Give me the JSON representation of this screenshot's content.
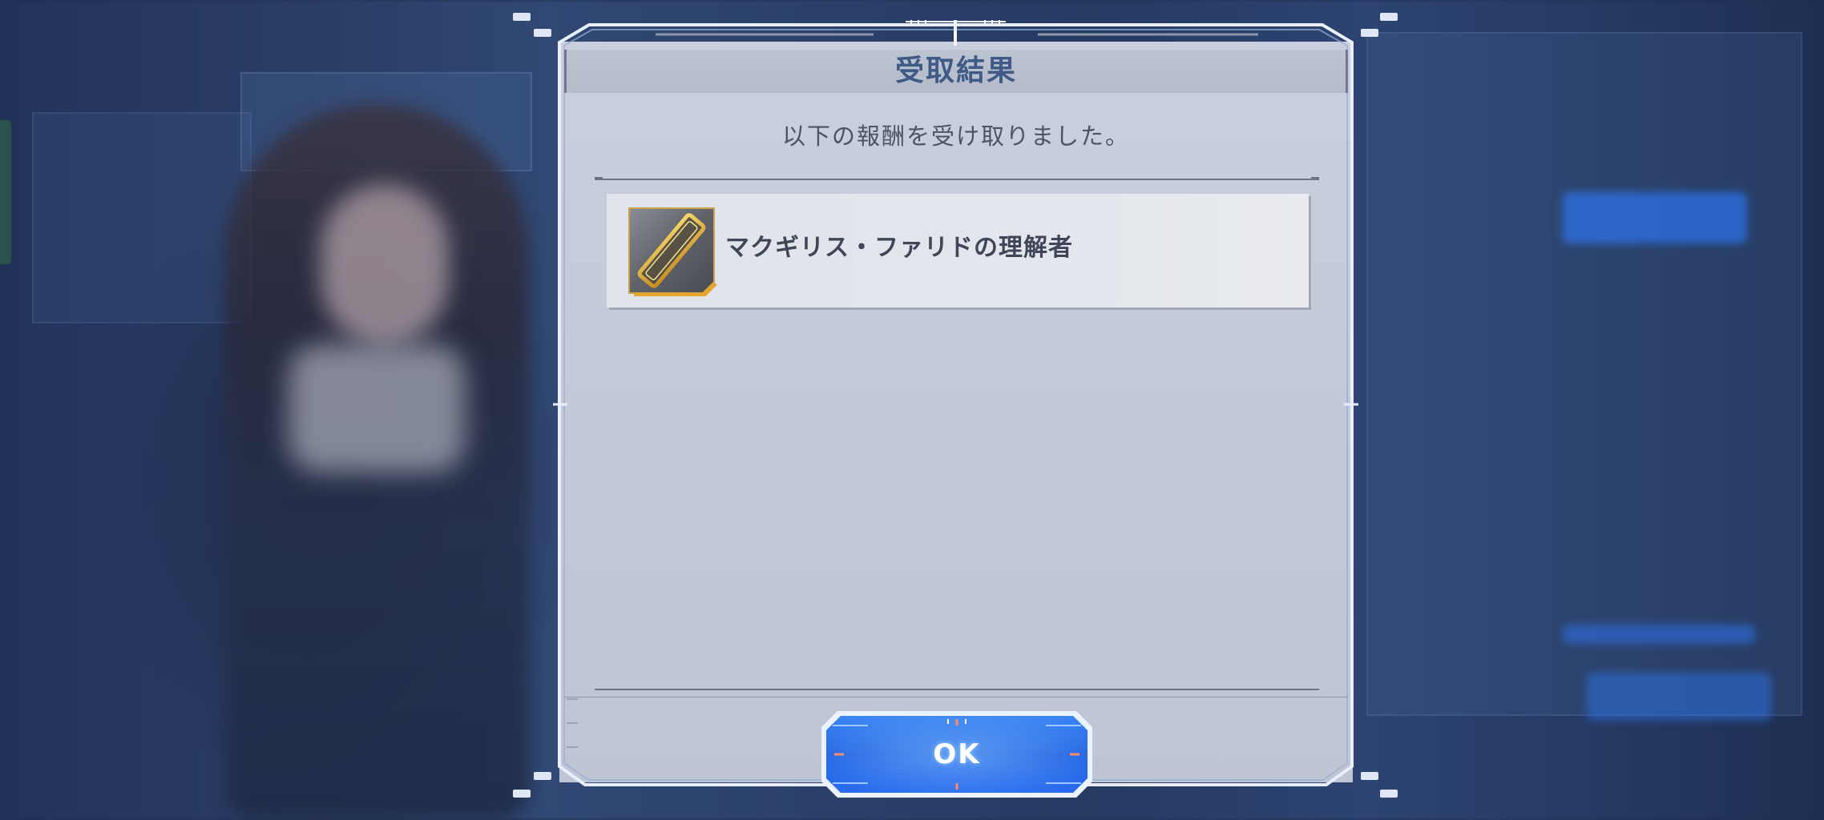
{
  "dialog": {
    "title": "受取結果",
    "message": "以下の報酬を受け取りました。",
    "rewards": [
      {
        "name": "マクギリス・ファリドの理解者",
        "icon": "gold-card-icon"
      }
    ],
    "ok_label": "OK"
  },
  "colors": {
    "title_text": "#3f5a86",
    "panel_bg": "#c6ccda",
    "ok_button": "#2a66e8",
    "icon_gold": "#d7a63a"
  }
}
